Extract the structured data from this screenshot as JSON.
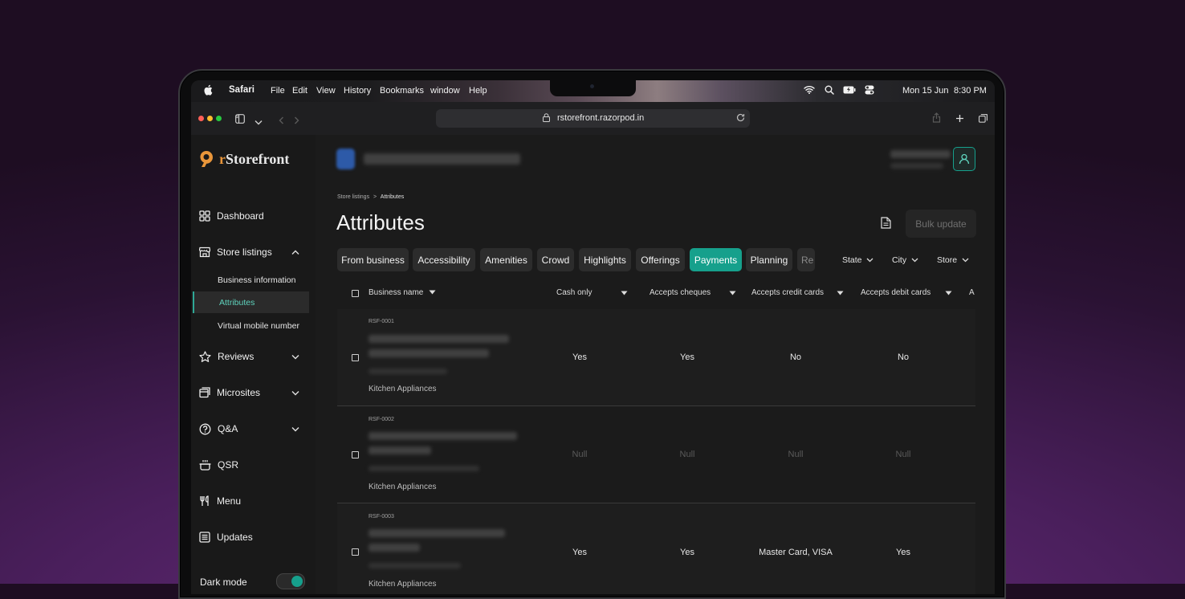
{
  "menubar": {
    "app_name": "Safari",
    "menus": [
      "File",
      "Edit",
      "View",
      "History",
      "Bookmarks",
      "window",
      "Help"
    ],
    "date": "Mon 15 Jun",
    "time": "8:30 PM"
  },
  "browser": {
    "url": "rstorefront.razorpod.in"
  },
  "brand": {
    "logo_text": "rStorefront",
    "accent_color": "#16a08c",
    "logo_color": "#e9963a"
  },
  "sidebar": {
    "items": [
      {
        "label": "Dashboard",
        "icon": "grid-icon"
      },
      {
        "label": "Store listings",
        "icon": "store-icon",
        "expanded": true
      },
      {
        "label": "Reviews",
        "icon": "star-icon"
      },
      {
        "label": "Microsites",
        "icon": "window-icon"
      },
      {
        "label": "Q&A",
        "icon": "question-icon"
      },
      {
        "label": "QSR",
        "icon": "pot-icon"
      },
      {
        "label": "Menu",
        "icon": "cutlery-icon"
      },
      {
        "label": "Updates",
        "icon": "list-icon"
      }
    ],
    "sub_items": [
      "Business information",
      "Attributes",
      "Virtual mobile number"
    ],
    "dark_mode_label": "Dark mode",
    "dark_mode_on": true
  },
  "breadcrumb": {
    "parent": "Store listings",
    "sep": ">",
    "current": "Attributes"
  },
  "page": {
    "title": "Attributes",
    "bulk_update_label": "Bulk update"
  },
  "tabs": [
    "From business",
    "Accessibility",
    "Amenities",
    "Crowd",
    "Highlights",
    "Offerings",
    "Payments",
    "Planning",
    "Re"
  ],
  "active_tab": "Payments",
  "filters": [
    "State",
    "City",
    "Store"
  ],
  "table": {
    "columns": [
      "Business name",
      "Cash only",
      "Accepts cheques",
      "Accepts credit cards",
      "Accepts debit cards",
      "A"
    ],
    "rows": [
      {
        "sku": "RSF-0001",
        "category": "Kitchen  Appliances",
        "values": [
          "Yes",
          "Yes",
          "No",
          "No"
        ]
      },
      {
        "sku": "RSF-0002",
        "category": "Kitchen  Appliances",
        "values": [
          "Null",
          "Null",
          "Null",
          "Null"
        ]
      },
      {
        "sku": "RSF-0003",
        "category": "Kitchen  Appliances",
        "values": [
          "Yes",
          "Yes",
          "Master Card, VISA",
          "Yes"
        ]
      }
    ]
  }
}
